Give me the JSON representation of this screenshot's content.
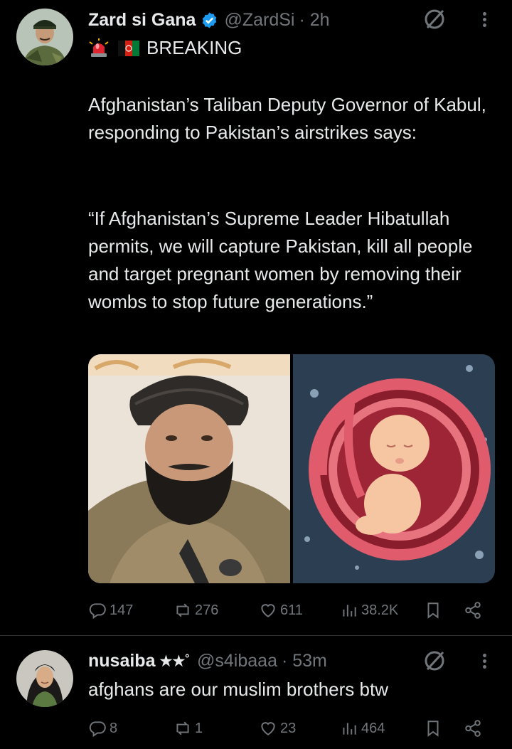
{
  "tweet1": {
    "display_name": "Zard si Gana",
    "handle": "@ZardSi",
    "time": "· 2h",
    "verified": true,
    "emoji_line": "🚨 🇦🇫",
    "breaking": "BREAKING",
    "paragraph1": "Afghanistan’s Taliban Deputy Governor of Kabul, responding to Pakistan’s airstrikes says:",
    "paragraph2": "“If Afghanistan’s Supreme Leader Hibatullah permits, we will capture Pakistan, kill all people and target pregnant women by removing their wombs to stop future generations.”",
    "images": [
      "man-in-turban-photo",
      "fetus-in-womb-illustration"
    ],
    "counts": {
      "replies": "147",
      "reposts": "276",
      "likes": "611",
      "views": "38.2K"
    }
  },
  "tweet2": {
    "display_name": "nusaiba",
    "name_decoration": "★★˚",
    "handle": "@s4ibaaa",
    "time": "· 53m",
    "text": "afghans are our muslim brothers btw",
    "counts": {
      "replies": "8",
      "reposts": "1",
      "likes": "23",
      "views": "464"
    }
  },
  "colors": {
    "background": "#000000",
    "text": "#e7e9ea",
    "muted": "#71767b",
    "verified": "#1d9bf0",
    "divider": "#2f3336"
  },
  "icons": [
    "grok-icon",
    "more-icon",
    "reply-icon",
    "repost-icon",
    "like-icon",
    "views-icon",
    "bookmark-icon",
    "share-icon",
    "verified-icon"
  ]
}
